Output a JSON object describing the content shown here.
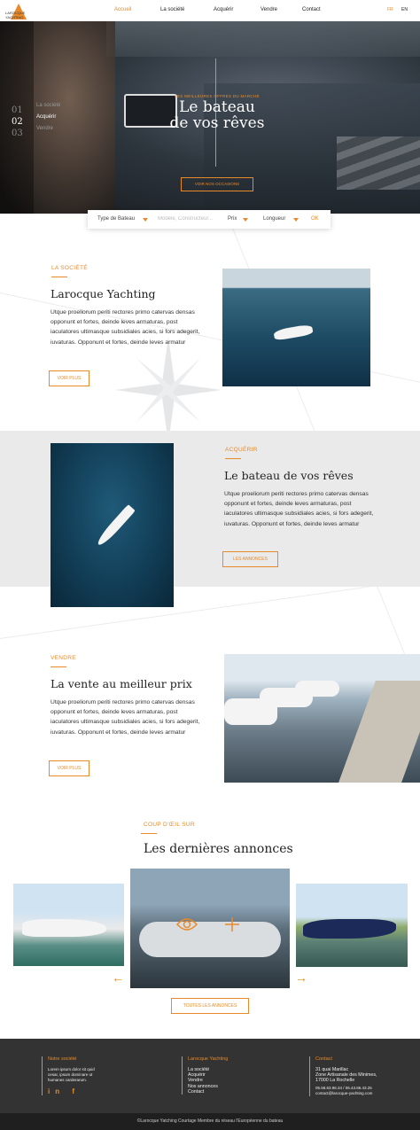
{
  "header": {
    "logo_text": "LAROCQUE YACHTING",
    "nav": [
      "Accueil",
      "La société",
      "Acquérir",
      "Vendre",
      "Contact"
    ],
    "active_nav": "Accueil",
    "lang": [
      "FR",
      "EN"
    ]
  },
  "hero": {
    "kicker": "LES MEILLEURES OFFRES DU MARCHÉ",
    "title_line1": "Le bateau",
    "title_line2": "de vos rêves",
    "button": "VOIR NOS OCCASIONS",
    "slides": [
      {
        "num": "01",
        "label": "La société"
      },
      {
        "num": "02",
        "label": "Acquérir"
      },
      {
        "num": "03",
        "label": "Vendre"
      }
    ]
  },
  "search": {
    "type": "Type de Bateau",
    "model_placeholder": "Modèle, Constructeur...",
    "price": "Prix",
    "length": "Longueur",
    "ok": "OK"
  },
  "sections": {
    "societe": {
      "kicker": "LA SOCIÉTÉ",
      "title": "Larocque Yachting",
      "text": "Utque proeliorum periti rectores primo catervas densas opponunt et fortes, deinde leves armaturas, post iaculatores ultimasque subsidiales acies, si fors adegerit, iuvaturas. Opponunt et fortes, deinde leves armatur",
      "button": "VOIR PLUS"
    },
    "acquerir": {
      "kicker": "ACQUÉRIR",
      "title": "Le bateau de vos rêves",
      "text": "Utque proeliorum periti rectores primo catervas densas opponunt et fortes, deinde leves armaturas, post iaculatores ultimasque subsidiales acies, si fors adegerit, iuvaturas. Opponunt et fortes, deinde leves armatur",
      "button": "LES ANNONCES"
    },
    "vendre": {
      "kicker": "VENDRE",
      "title": "La vente au meilleur prix",
      "text": "Utque proeliorum periti rectores primo catervas densas opponunt et fortes, deinde leves armaturas, post iaculatores ultimasque subsidiales acies, si fors adegerit, iuvaturas. Opponunt et fortes, deinde leves armatur",
      "button": "VOIR PLUS"
    }
  },
  "listings": {
    "kicker": "COUP D'ŒIL SUR",
    "title": "Les dernières annonces",
    "button": "TOUTES LES ANNONCES"
  },
  "footer": {
    "col1_title": "Notre société",
    "col1_text": [
      "Lorem ipsum dolor sit quid",
      "cesar, ipsum dominare ut",
      "humanes carderarum."
    ],
    "social": "in f",
    "col2_title": "Larocque Yachting",
    "col2_links": [
      "La société",
      "Acquérir",
      "Vendre",
      "Nos annonces",
      "Contact"
    ],
    "col3_title": "Contact",
    "col3_lines": [
      "31 quai Marillac",
      "Zone Artisanale des Minimes,",
      "17000 La Rochelle"
    ],
    "col3_phone": "05.58.63.96.34 / 06.43.86.43.25",
    "col3_email": "contact@larocque-yachting.com",
    "copyright": "©Larocque Yatching Courtage   Membre du réseau l'Européenne du bateau"
  },
  "colors": {
    "accent": "#e88a2a",
    "footer_bg": "#333333",
    "gray_band": "#eaeaea"
  }
}
